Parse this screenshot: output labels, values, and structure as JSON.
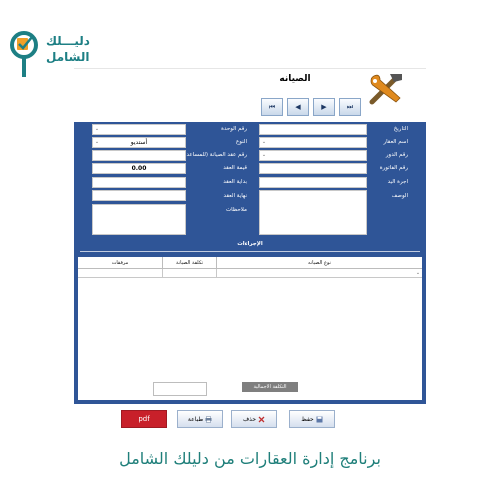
{
  "brand": {
    "line1": "دليـــلك",
    "line2": "الشامل",
    "color": "#1d7f84"
  },
  "form": {
    "title": "الصيانه"
  },
  "nav": {
    "first": "⏮",
    "prev": "◀",
    "next": "▶",
    "last": "⏭"
  },
  "left_column": {
    "labels": [
      "التاريخ",
      "اسم العقار",
      "رقم الدور",
      "رقم الفاتورة",
      "اجرة اليد",
      "الوصف"
    ],
    "date_value": ""
  },
  "right_column": {
    "labels": [
      "رقم الوحدة",
      "النوع",
      "رقم عقد الصيانة (للمساعد)",
      "قيمة العقد",
      "بداية العقد",
      "نهاية العقد",
      "ملاحظات"
    ],
    "type_value": "أستديو",
    "contract_value": "0.00"
  },
  "actions": {
    "title": "الإجراءات",
    "columns": [
      "مرفقات",
      "تكلفة الصيانة",
      "نوع الصيانه"
    ],
    "total_label": "التكلفة الاجمالية"
  },
  "buttons": {
    "pdf": "pdf",
    "print": "طباعة",
    "delete": "حذف",
    "save": "حفظ"
  },
  "footer": {
    "title": "برنامج إدارة العقارات من دليلك الشامل"
  },
  "colors": {
    "panel": "#2f5597",
    "pdf_button": "#c8202a",
    "footer_text": "#1f7f7a"
  }
}
